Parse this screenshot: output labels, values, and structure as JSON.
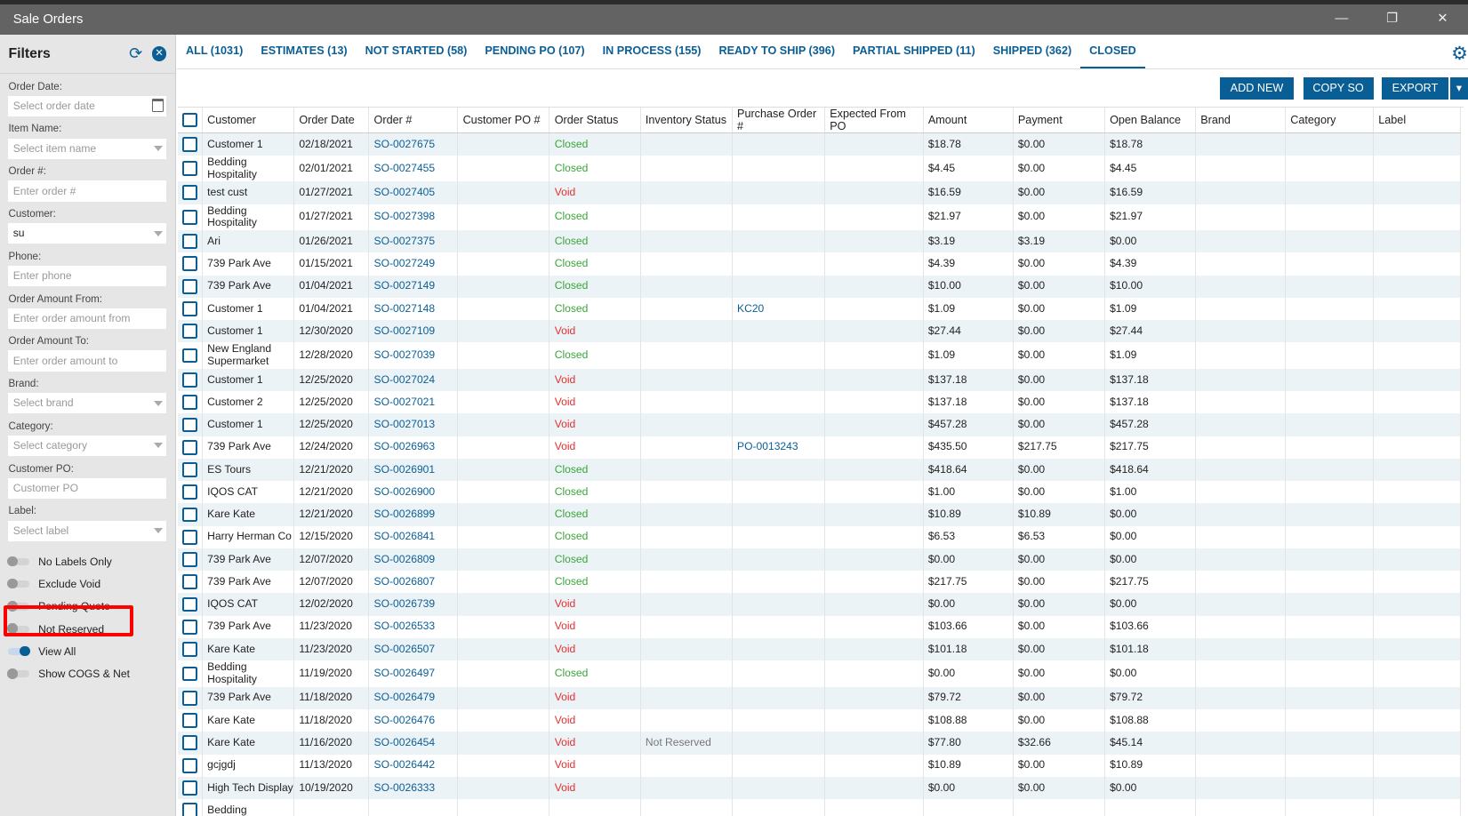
{
  "window": {
    "title": "Sale Orders",
    "minimize": "—",
    "restore": "❐",
    "close": "✕"
  },
  "filters": {
    "title": "Filters",
    "fields": [
      {
        "label": "Order Date:",
        "placeholder": "Select order date",
        "type": "date"
      },
      {
        "label": "Item Name:",
        "placeholder": "Select item name",
        "type": "select"
      },
      {
        "label": "Order #:",
        "placeholder": "Enter order #",
        "type": "text"
      },
      {
        "label": "Customer:",
        "value": "su",
        "type": "select"
      },
      {
        "label": "Phone:",
        "placeholder": "Enter phone",
        "type": "text"
      },
      {
        "label": "Order Amount From:",
        "placeholder": "Enter order amount from",
        "type": "text"
      },
      {
        "label": "Order Amount To:",
        "placeholder": "Enter order amount to",
        "type": "text"
      },
      {
        "label": "Brand:",
        "placeholder": "Select brand",
        "type": "select"
      },
      {
        "label": "Category:",
        "placeholder": "Select category",
        "type": "select"
      },
      {
        "label": "Customer PO:",
        "placeholder": "Customer PO",
        "type": "text"
      },
      {
        "label": "Label:",
        "placeholder": "Select label",
        "type": "select"
      }
    ],
    "toggles": [
      {
        "label": "No Labels Only",
        "on": false
      },
      {
        "label": "Exclude Void",
        "on": false
      },
      {
        "label": "Pending Quote",
        "on": false
      },
      {
        "label": "Not Reserved",
        "on": false
      },
      {
        "label": "View All",
        "on": true
      },
      {
        "label": "Show COGS & Net",
        "on": false
      }
    ]
  },
  "tabs": [
    "ALL (1031)",
    "ESTIMATES (13)",
    "NOT STARTED (58)",
    "PENDING PO (107)",
    "IN PROCESS (155)",
    "READY TO SHIP (396)",
    "PARTIAL SHIPPED (11)",
    "SHIPPED (362)",
    "CLOSED"
  ],
  "active_tab": 8,
  "buttons": {
    "add_new": "ADD NEW",
    "copy_so": "COPY SO",
    "export": "EXPORT"
  },
  "columns": [
    "Customer",
    "Order Date",
    "Order #",
    "Customer PO #",
    "Order Status",
    "Inventory Status",
    "Purchase Order #",
    "Expected From PO",
    "Amount",
    "Payment",
    "Open Balance",
    "Brand",
    "Category",
    "Label"
  ],
  "rows": [
    [
      "Customer 1",
      "02/18/2021",
      "SO-0027675",
      "",
      "Closed",
      "",
      "",
      "",
      "$18.78",
      "$0.00",
      "$18.78"
    ],
    [
      "Bedding Hospitality",
      "02/01/2021",
      "SO-0027455",
      "",
      "Closed",
      "",
      "",
      "",
      "$4.45",
      "$0.00",
      "$4.45"
    ],
    [
      "test cust",
      "01/27/2021",
      "SO-0027405",
      "",
      "Void",
      "",
      "",
      "",
      "$16.59",
      "$0.00",
      "$16.59"
    ],
    [
      "Bedding Hospitality",
      "01/27/2021",
      "SO-0027398",
      "",
      "Closed",
      "",
      "",
      "",
      "$21.97",
      "$0.00",
      "$21.97"
    ],
    [
      "Ari",
      "01/26/2021",
      "SO-0027375",
      "",
      "Closed",
      "",
      "",
      "",
      "$3.19",
      "$3.19",
      "$0.00"
    ],
    [
      "739 Park Ave",
      "01/15/2021",
      "SO-0027249",
      "",
      "Closed",
      "",
      "",
      "",
      "$4.39",
      "$0.00",
      "$4.39"
    ],
    [
      "739 Park Ave",
      "01/04/2021",
      "SO-0027149",
      "",
      "Closed",
      "",
      "",
      "",
      "$10.00",
      "$0.00",
      "$10.00"
    ],
    [
      "Customer 1",
      "01/04/2021",
      "SO-0027148",
      "",
      "Closed",
      "",
      "KC20",
      "",
      "$1.09",
      "$0.00",
      "$1.09"
    ],
    [
      "Customer 1",
      "12/30/2020",
      "SO-0027109",
      "",
      "Void",
      "",
      "",
      "",
      "$27.44",
      "$0.00",
      "$27.44"
    ],
    [
      "New England Supermarket",
      "12/28/2020",
      "SO-0027039",
      "",
      "Closed",
      "",
      "",
      "",
      "$1.09",
      "$0.00",
      "$1.09"
    ],
    [
      "Customer 1",
      "12/25/2020",
      "SO-0027024",
      "",
      "Void",
      "",
      "",
      "",
      "$137.18",
      "$0.00",
      "$137.18"
    ],
    [
      "Customer 2",
      "12/25/2020",
      "SO-0027021",
      "",
      "Void",
      "",
      "",
      "",
      "$137.18",
      "$0.00",
      "$137.18"
    ],
    [
      "Customer 1",
      "12/25/2020",
      "SO-0027013",
      "",
      "Void",
      "",
      "",
      "",
      "$457.28",
      "$0.00",
      "$457.28"
    ],
    [
      "739 Park Ave",
      "12/24/2020",
      "SO-0026963",
      "",
      "Void",
      "",
      "PO-0013243",
      "",
      "$435.50",
      "$217.75",
      "$217.75"
    ],
    [
      "ES Tours",
      "12/21/2020",
      "SO-0026901",
      "",
      "Closed",
      "",
      "",
      "",
      "$418.64",
      "$0.00",
      "$418.64"
    ],
    [
      "IQOS CAT",
      "12/21/2020",
      "SO-0026900",
      "",
      "Closed",
      "",
      "",
      "",
      "$1.00",
      "$0.00",
      "$1.00"
    ],
    [
      "Kare Kate",
      "12/21/2020",
      "SO-0026899",
      "",
      "Closed",
      "",
      "",
      "",
      "$10.89",
      "$10.89",
      "$0.00"
    ],
    [
      "Harry Herman Co",
      "12/15/2020",
      "SO-0026841",
      "",
      "Closed",
      "",
      "",
      "",
      "$6.53",
      "$6.53",
      "$0.00"
    ],
    [
      "739 Park Ave",
      "12/07/2020",
      "SO-0026809",
      "",
      "Closed",
      "",
      "",
      "",
      "$0.00",
      "$0.00",
      "$0.00"
    ],
    [
      "739 Park Ave",
      "12/07/2020",
      "SO-0026807",
      "",
      "Closed",
      "",
      "",
      "",
      "$217.75",
      "$0.00",
      "$217.75"
    ],
    [
      "IQOS CAT",
      "12/02/2020",
      "SO-0026739",
      "",
      "Void",
      "",
      "",
      "",
      "$0.00",
      "$0.00",
      "$0.00"
    ],
    [
      "739 Park Ave",
      "11/23/2020",
      "SO-0026533",
      "",
      "Void",
      "",
      "",
      "",
      "$103.66",
      "$0.00",
      "$103.66"
    ],
    [
      "Kare Kate",
      "11/23/2020",
      "SO-0026507",
      "",
      "Void",
      "",
      "",
      "",
      "$101.18",
      "$0.00",
      "$101.18"
    ],
    [
      "Bedding Hospitality",
      "11/19/2020",
      "SO-0026497",
      "",
      "Closed",
      "",
      "",
      "",
      "$0.00",
      "$0.00",
      "$0.00"
    ],
    [
      "739 Park Ave",
      "11/18/2020",
      "SO-0026479",
      "",
      "Void",
      "",
      "",
      "",
      "$79.72",
      "$0.00",
      "$79.72"
    ],
    [
      "Kare Kate",
      "11/18/2020",
      "SO-0026476",
      "",
      "Void",
      "",
      "",
      "",
      "$108.88",
      "$0.00",
      "$108.88"
    ],
    [
      "Kare Kate",
      "11/16/2020",
      "SO-0026454",
      "",
      "Void",
      "Not Reserved",
      "",
      "",
      "$77.80",
      "$32.66",
      "$45.14"
    ],
    [
      "gcjgdj",
      "11/13/2020",
      "SO-0026442",
      "",
      "Void",
      "",
      "",
      "",
      "$10.89",
      "$0.00",
      "$10.89"
    ],
    [
      "High Tech Display",
      "10/19/2020",
      "SO-0026333",
      "",
      "Void",
      "",
      "",
      "",
      "$0.00",
      "$0.00",
      "$0.00"
    ],
    [
      "Bedding",
      "",
      "",
      "",
      "",
      "",
      "",
      "",
      "",
      "",
      ""
    ]
  ]
}
